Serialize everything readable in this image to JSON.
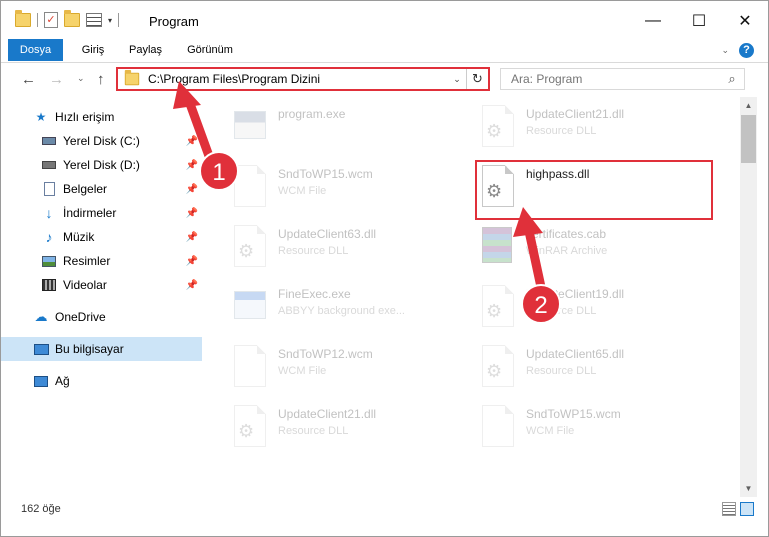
{
  "window": {
    "title": "Program",
    "controls": {
      "minimize": "—",
      "maximize": "☐",
      "close": "✕"
    }
  },
  "ribbon": {
    "tabs": [
      {
        "label": "Dosya",
        "active": true
      },
      {
        "label": "Giriş"
      },
      {
        "label": "Paylaş"
      },
      {
        "label": "Görünüm"
      }
    ]
  },
  "navigation": {
    "address": "C:\\Program Files\\Program Dizini",
    "search_placeholder": "Ara: Program"
  },
  "sidebar": {
    "quick_access": "Hızlı erişim",
    "items": [
      {
        "label": "Yerel Disk (C:)",
        "icon": "drive-icon"
      },
      {
        "label": "Yerel Disk (D:)",
        "icon": "drive-icon"
      },
      {
        "label": "Belgeler",
        "icon": "documents-icon"
      },
      {
        "label": "İndirmeler",
        "icon": "download-icon"
      },
      {
        "label": "Müzik",
        "icon": "music-icon"
      },
      {
        "label": "Resimler",
        "icon": "pictures-icon"
      },
      {
        "label": "Videolar",
        "icon": "videos-icon"
      }
    ],
    "onedrive": "OneDrive",
    "this_pc": "Bu bilgisayar",
    "network": "Ağ"
  },
  "files": {
    "left": [
      {
        "name": "program.exe",
        "type": ""
      },
      {
        "name": "SndToWP15.wcm",
        "type": "WCM File"
      },
      {
        "name": "UpdateClient63.dll",
        "type": "Resource DLL"
      },
      {
        "name": "FineExec.exe",
        "type": "ABBYY background exe..."
      },
      {
        "name": "SndToWP12.wcm",
        "type": "WCM File"
      },
      {
        "name": "UpdateClient21.dll",
        "type": "Resource DLL"
      }
    ],
    "right": [
      {
        "name": "UpdateClient21.dll",
        "type": "Resource DLL"
      },
      {
        "name": "highpass.dll",
        "type": ""
      },
      {
        "name": "certificates.cab",
        "type": "WinRAR Archive"
      },
      {
        "name": "UpdateClient19.dll",
        "type": "Resource DLL"
      },
      {
        "name": "UpdateClient65.dll",
        "type": "Resource DLL"
      },
      {
        "name": "SndToWP15.wcm",
        "type": "WCM File"
      }
    ]
  },
  "annotations": {
    "step1": "1",
    "step2": "2",
    "color": "#e0303a"
  },
  "status": {
    "count": "162 öğe"
  }
}
